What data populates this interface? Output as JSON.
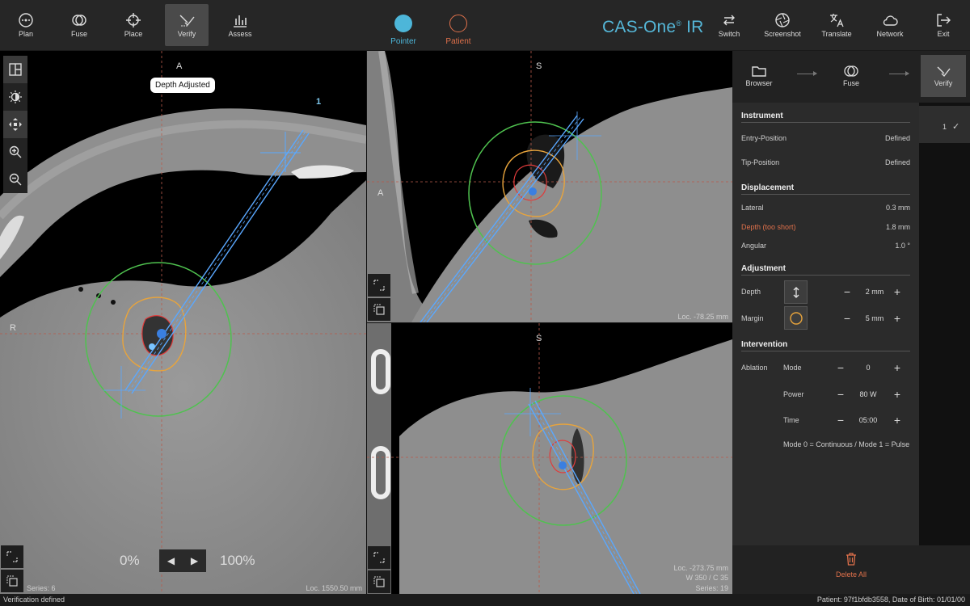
{
  "toolbar": {
    "left": [
      {
        "label": "Plan",
        "icon": "plan-icon"
      },
      {
        "label": "Fuse",
        "icon": "fuse-icon"
      },
      {
        "label": "Place",
        "icon": "crosshair-icon"
      },
      {
        "label": "Verify",
        "icon": "verify-icon",
        "active": true
      },
      {
        "label": "Assess",
        "icon": "chart-icon"
      }
    ],
    "modes": [
      {
        "label": "Pointer",
        "color": "#4db6d9"
      },
      {
        "label": "Patient",
        "color": "#e0714b"
      }
    ],
    "brand": "CAS-One",
    "brand_suffix": " IR",
    "brand_sup": "®",
    "right": [
      {
        "label": "Switch",
        "icon": "switch-icon"
      },
      {
        "label": "Screenshot",
        "icon": "aperture-icon"
      },
      {
        "label": "Translate",
        "icon": "translate-icon"
      },
      {
        "label": "Network",
        "icon": "cloud-icon"
      },
      {
        "label": "Exit",
        "icon": "exit-icon"
      }
    ]
  },
  "viewport_main": {
    "orient_top": "A",
    "orient_left": "R",
    "needle_label": "1",
    "tooltip": "Depth Adjusted",
    "opacity_min": "0%",
    "opacity_max": "100%",
    "series": "Series: 6",
    "loc": "Loc. 1550.50 mm"
  },
  "viewport_top_right": {
    "orient_top": "S",
    "orient_left": "A",
    "loc": "Loc. -78.25 mm"
  },
  "viewport_bottom_right": {
    "orient_top": "S",
    "loc": "Loc. -273.75 mm",
    "window": "W 350 / C 35",
    "series": "Series: 19"
  },
  "workflow": {
    "steps": [
      {
        "label": "Browser",
        "icon": "folder-icon"
      },
      {
        "label": "Fuse",
        "icon": "fuse-icon"
      },
      {
        "label": "Verify",
        "icon": "verify-icon",
        "active": true
      }
    ]
  },
  "instrument": {
    "title": "Instrument",
    "entry_label": "Entry-Position",
    "entry_value": "Defined",
    "tip_label": "Tip-Position",
    "tip_value": "Defined"
  },
  "displacement": {
    "title": "Displacement",
    "lateral_label": "Lateral",
    "lateral_value": "0.3 mm",
    "depth_label": "Depth (too short)",
    "depth_value": "1.8 mm",
    "angular_label": "Angular",
    "angular_value": "1.0 °"
  },
  "adjustment": {
    "title": "Adjustment",
    "depth_label": "Depth",
    "depth_value": "2 mm",
    "margin_label": "Margin",
    "margin_value": "5 mm"
  },
  "intervention": {
    "title": "Intervention",
    "ablation_label": "Ablation",
    "mode_label": "Mode",
    "mode_value": "0",
    "power_label": "Power",
    "power_value": "80 W",
    "time_label": "Time",
    "time_value": "05:00",
    "note": "Mode 0 = Continuous / Mode 1 = Pulse"
  },
  "side_list": {
    "items": [
      {
        "label": "1",
        "checked": true
      }
    ]
  },
  "delete_all": "Delete All",
  "status": {
    "left": "Verification defined",
    "right": "Patient: 97f1bfdb3558, Date of Birth: 01/01/00"
  },
  "colors": {
    "accent": "#4db6d9",
    "warning": "#e0714b",
    "margin_ring": "#4fc24f",
    "target_ring": "#e8a43c",
    "lesion": "#e03b3b",
    "needle": "#5aa8ff"
  }
}
